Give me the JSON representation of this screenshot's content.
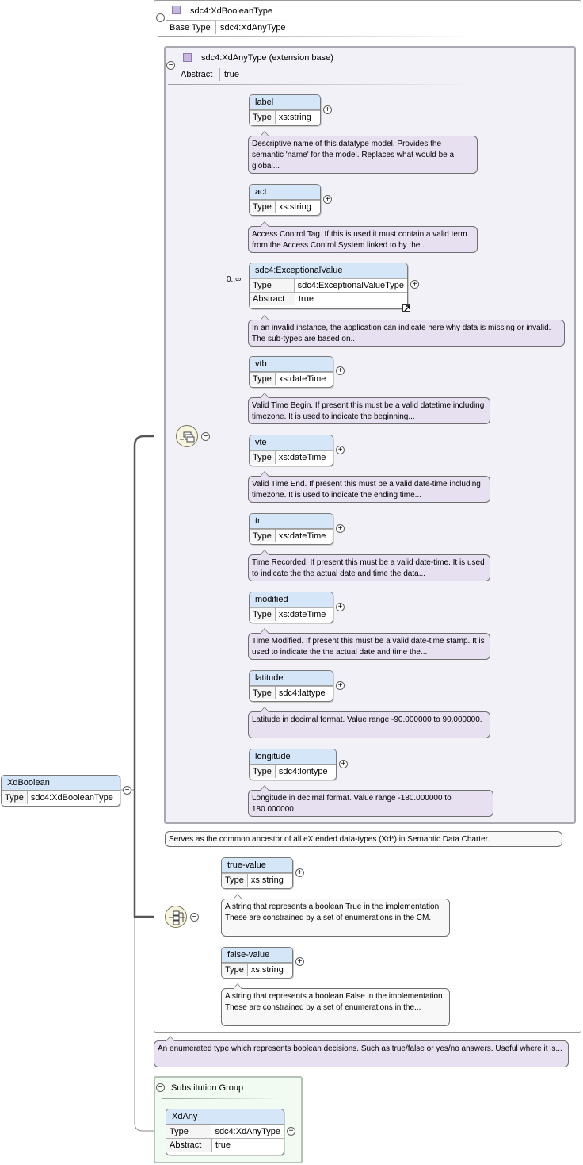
{
  "root": {
    "name": "XdBoolean",
    "type_label": "Type",
    "type_value": "sdc4:XdBooleanType"
  },
  "complex_type": {
    "name": "sdc4:XdBooleanType",
    "base_type_label": "Base Type",
    "base_type_value": "sdc4:XdAnyType"
  },
  "extension": {
    "name": "sdc4:XdAnyType (extension base)",
    "abstract_label": "Abstract",
    "abstract_value": "true"
  },
  "expand_symbol": "+",
  "collapse_symbol": "−",
  "sequence_elements": [
    {
      "name": "label",
      "type_label": "Type",
      "type_value": "xs:string",
      "note": "Descriptive name of this datatype model. Provides the semantic 'name' for the model. Replaces what would be a global..."
    },
    {
      "name": "act",
      "type_label": "Type",
      "type_value": "xs:string",
      "note": "Access Control Tag. If this is used it must contain a valid term from the Access Control System linked to by the..."
    },
    {
      "name": "sdc4:ExceptionalValue",
      "cardinality": "0..∞",
      "type_label": "Type",
      "type_value": "sdc4:ExceptionalValueType",
      "abstract_label": "Abstract",
      "abstract_value": "true",
      "note": "In an invalid instance, the application can indicate here why data is missing or invalid. The sub-types are based on..."
    },
    {
      "name": "vtb",
      "type_label": "Type",
      "type_value": "xs:dateTime",
      "note": "Valid Time Begin. If present this must be a valid datetime including timezone. It is used to indicate the beginning..."
    },
    {
      "name": "vte",
      "type_label": "Type",
      "type_value": "xs:dateTime",
      "note": "Valid Time End. If present this must be a valid date-time including timezone. It is used to indicate the ending time..."
    },
    {
      "name": "tr",
      "type_label": "Type",
      "type_value": "xs:dateTime",
      "note": "Time Recorded. If present this must be a valid date-time. It is used to indicate the the actual date and time the data..."
    },
    {
      "name": "modified",
      "type_label": "Type",
      "type_value": "xs:dateTime",
      "note": "Time Modified. If present this must be a valid date-time stamp. It is used to indicate the the actual date and time the..."
    },
    {
      "name": "latitude",
      "type_label": "Type",
      "type_value": "sdc4:lattype",
      "note": "Latitude in decimal format. Value range -90.000000 to 90.000000."
    },
    {
      "name": "longitude",
      "type_label": "Type",
      "type_value": "sdc4:lontype",
      "note": "Longitude in decimal format. Value range -180.000000 to 180.000000."
    }
  ],
  "extension_note": "Serves as the common ancestor of all eXtended data-types (Xd*) in Semantic Data Charter.",
  "choice_elements": [
    {
      "name": "true-value",
      "type_label": "Type",
      "type_value": "xs:string",
      "note": "A string that represents a boolean True in the implementation. These are constrained by a set of enumerations in the CM."
    },
    {
      "name": "false-value",
      "type_label": "Type",
      "type_value": "xs:string",
      "note": "A string that represents a boolean False in the implementation. These are constrained by a set of enumerations in the..."
    }
  ],
  "root_note": "An enumerated type which represents boolean decisions. Such as true/false or yes/no answers. Useful where it is...",
  "substitution": {
    "title": "Substitution Group",
    "name": "XdAny",
    "type_label": "Type",
    "type_value": "sdc4:XdAnyType",
    "abstract_label": "Abstract",
    "abstract_value": "true"
  },
  "colors": {
    "element_header": "#d6e6f9",
    "note_purple": "#e6e0f0",
    "note_white": "#f8f8f8",
    "extension_bg": "#f3f1f8",
    "substitution_bg": "#f1fbf1",
    "compositor": "#f7f4df"
  }
}
